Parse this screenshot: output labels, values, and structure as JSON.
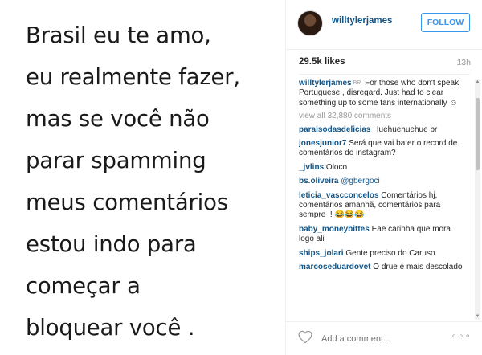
{
  "post": {
    "text_lines": [
      "Brasil eu te amo,",
      "eu realmente fazer,",
      "mas se você não",
      "parar spamming",
      "meus comentários",
      "estou indo para",
      "começar a",
      "bloquear você ."
    ]
  },
  "header": {
    "username": "willtylerjames",
    "follow_label": "FOLLOW"
  },
  "stats": {
    "likes": "29.5k likes",
    "time": "13h"
  },
  "caption": {
    "username": "willtylerjames",
    "badge": "BR",
    "text": "For those who don't speak Portuguese , disregard. Just had to clear something up to some fans internationally ☺"
  },
  "view_all": "view all 32,880 comments",
  "comments": [
    {
      "username": "paraisodasdelicias",
      "text": "Huehuehuehue br"
    },
    {
      "username": "jonesjunior7",
      "text": "Será que vai bater o record de comentários do instagram?"
    },
    {
      "username": "_jvlins",
      "text": "Oloco"
    },
    {
      "username": "bs.oliveira",
      "text": "@gbergoci"
    },
    {
      "username": "leticia_vascconcelos",
      "text": "Comentários hj, comentários amanhã, comentários para sempre !! 😂😂😂"
    },
    {
      "username": "baby_moneybittes",
      "text": "Eae carinha que mora logo ali"
    },
    {
      "username": "ships_jolari",
      "text": "Gente preciso do Caruso"
    },
    {
      "username": "marcoseduardovet",
      "text": "O drue é mais descolado"
    }
  ],
  "footer": {
    "add_comment_placeholder": "Add a comment...",
    "more_label": "∘∘∘"
  },
  "icons": {
    "heart": "heart-icon",
    "avatar": "profile-avatar",
    "more": "more-options-icon"
  },
  "colors": {
    "username": "#125688",
    "follow": "#3897f0",
    "muted": "#999999"
  }
}
